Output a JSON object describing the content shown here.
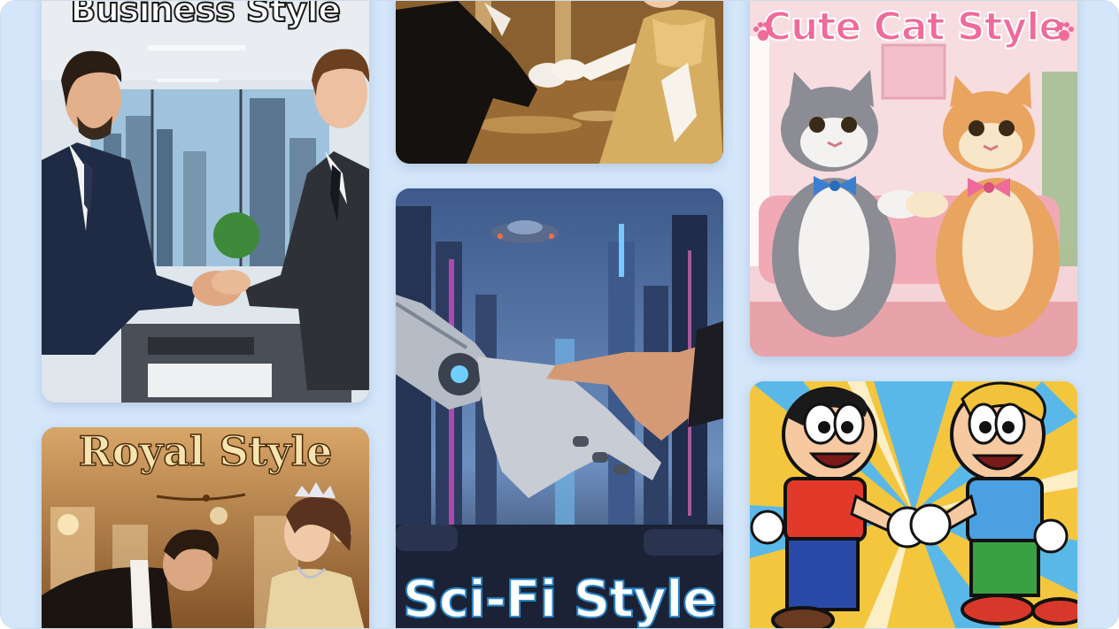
{
  "gallery": {
    "cards": {
      "business": {
        "title": "Business Style"
      },
      "royal": {
        "title": "Royal Style"
      },
      "ballroom": {
        "title": ""
      },
      "scifi": {
        "title": "Sci-Fi Style"
      },
      "cat": {
        "title": "Cute Cat Style"
      },
      "cartoon": {
        "title": ""
      }
    }
  },
  "colors": {
    "background": "#d4e6fa",
    "cat_title": "#f06a9a",
    "royal_title": "#f7e3b0",
    "scifi_title_outline": "#2a86c8"
  },
  "icons": [
    "paw-icon-left",
    "paw-icon-right",
    "crown-ornament-icon"
  ]
}
